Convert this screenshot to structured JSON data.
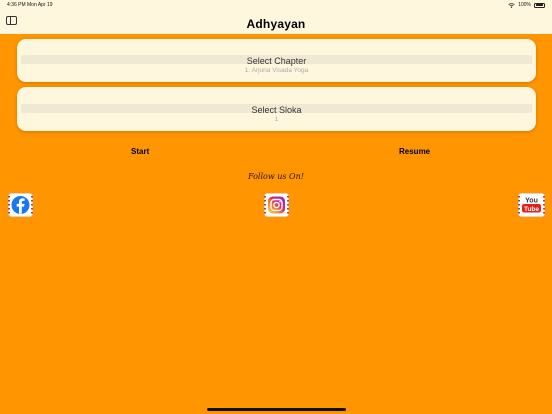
{
  "status_bar": {
    "time_date": "4:36 PM  Mon Apr 19",
    "battery": "100%"
  },
  "nav": {
    "title": "Adhyayan"
  },
  "chapter": {
    "label": "Select Chapter",
    "value": "1. Arjuna Visada Yoga"
  },
  "sloka": {
    "label": "Select Sloka",
    "value": "1"
  },
  "actions": {
    "start": "Start",
    "resume": "Resume"
  },
  "social": {
    "heading": "Follow us On!",
    "youtube_you": "You",
    "youtube_tube": "Tube"
  },
  "colors": {
    "background": "#FF9501",
    "card": "#FFF7DD",
    "facebook": "#1877F2",
    "youtube": "#E62117"
  }
}
